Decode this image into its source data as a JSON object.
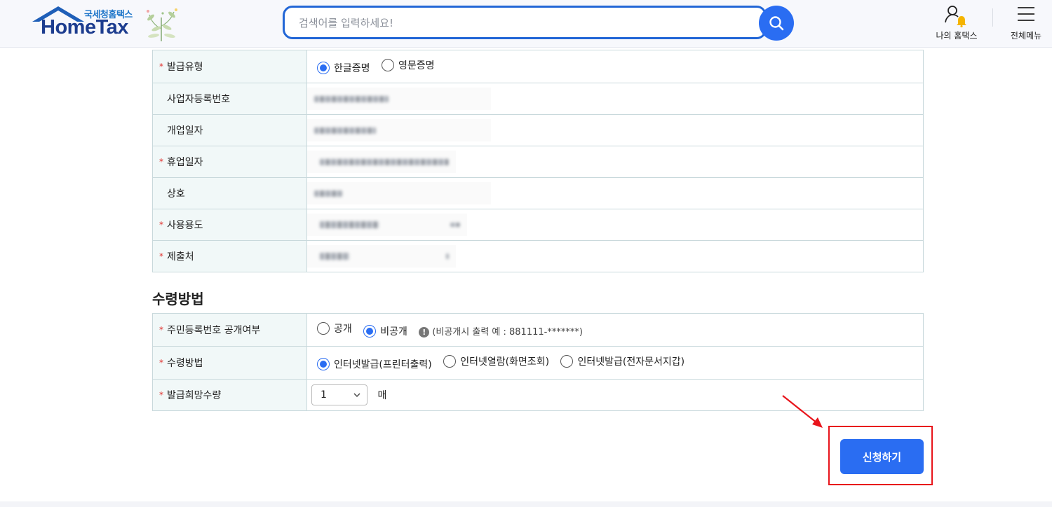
{
  "header": {
    "logo_sub": "국세청홈택스",
    "logo_main": "HomeTax",
    "search_placeholder": "검색어를 입력하세요!",
    "my_hometax_label": "나의 홈택스",
    "all_menu_label": "전체메뉴"
  },
  "issue_info": {
    "rows": [
      {
        "label": "발급유형",
        "required": true
      },
      {
        "label": "사업자등록번호",
        "required": false
      },
      {
        "label": "개업일자",
        "required": false
      },
      {
        "label": "휴업일자",
        "required": true
      },
      {
        "label": "상호",
        "required": false
      },
      {
        "label": "사용용도",
        "required": true
      },
      {
        "label": "제출처",
        "required": true
      }
    ],
    "issue_type_options": [
      {
        "label": "한글증명",
        "selected": true
      },
      {
        "label": "영문증명",
        "selected": false
      }
    ]
  },
  "receive_section": {
    "title": "수령방법",
    "rows": [
      {
        "label": "주민등록번호 공개여부",
        "required": true
      },
      {
        "label": "수령방법",
        "required": true
      },
      {
        "label": "발급희망수량",
        "required": true
      }
    ],
    "disclosure_options": [
      {
        "label": "공개",
        "selected": false
      },
      {
        "label": "비공개",
        "selected": true
      }
    ],
    "disclosure_note": "(비공개시 출력 예 : 881111-*******)",
    "method_options": [
      {
        "label": "인터넷발급(프린터출력)",
        "selected": true
      },
      {
        "label": "인터넷열람(화면조회)",
        "selected": false
      },
      {
        "label": "인터넷발급(전자문서지갑)",
        "selected": false
      }
    ],
    "quantity_value": "1",
    "quantity_unit": "매"
  },
  "submit_label": "신청하기",
  "required_mark": "*",
  "info_mark": "!",
  "colors": {
    "accent": "#2a6df2",
    "required": "#e0322e",
    "highlight": "#e8141b",
    "header_bg": "#f7f8fc",
    "label_bg": "#f1f8f8"
  }
}
